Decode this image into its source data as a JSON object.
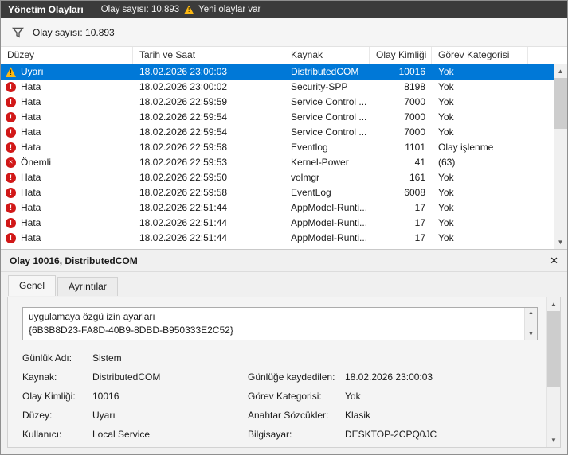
{
  "title_bar": {
    "title": "Yönetim Olayları",
    "event_count": "Olay sayısı: 10.893",
    "new_events": "Yeni olaylar var"
  },
  "filter_bar": {
    "event_count": "Olay sayısı: 10.893"
  },
  "table": {
    "columns": [
      "Düzey",
      "Tarih ve Saat",
      "Kaynak",
      "Olay Kimliği",
      "Görev Kategorisi"
    ],
    "rows": [
      {
        "icon": "warning",
        "level": "Uyarı",
        "datetime": "18.02.2026 23:00:03",
        "source": "DistributedCOM",
        "event_id": "10016",
        "category": "Yok",
        "selected": true
      },
      {
        "icon": "error",
        "level": "Hata",
        "datetime": "18.02.2026 23:00:02",
        "source": "Security-SPP",
        "event_id": "8198",
        "category": "Yok",
        "selected": false
      },
      {
        "icon": "error",
        "level": "Hata",
        "datetime": "18.02.2026 22:59:59",
        "source": "Service Control ...",
        "event_id": "7000",
        "category": "Yok",
        "selected": false
      },
      {
        "icon": "error",
        "level": "Hata",
        "datetime": "18.02.2026 22:59:54",
        "source": "Service Control ...",
        "event_id": "7000",
        "category": "Yok",
        "selected": false
      },
      {
        "icon": "error",
        "level": "Hata",
        "datetime": "18.02.2026 22:59:54",
        "source": "Service Control ...",
        "event_id": "7000",
        "category": "Yok",
        "selected": false
      },
      {
        "icon": "error",
        "level": "Hata",
        "datetime": "18.02.2026 22:59:58",
        "source": "Eventlog",
        "event_id": "1101",
        "category": "Olay işlenme",
        "selected": false
      },
      {
        "icon": "critical",
        "level": "Önemli",
        "datetime": "18.02.2026 22:59:53",
        "source": "Kernel-Power",
        "event_id": "41",
        "category": "(63)",
        "selected": false
      },
      {
        "icon": "error",
        "level": "Hata",
        "datetime": "18.02.2026 22:59:50",
        "source": "volmgr",
        "event_id": "161",
        "category": "Yok",
        "selected": false
      },
      {
        "icon": "error",
        "level": "Hata",
        "datetime": "18.02.2026 22:59:58",
        "source": "EventLog",
        "event_id": "6008",
        "category": "Yok",
        "selected": false
      },
      {
        "icon": "error",
        "level": "Hata",
        "datetime": "18.02.2026 22:51:44",
        "source": "AppModel-Runti...",
        "event_id": "17",
        "category": "Yok",
        "selected": false
      },
      {
        "icon": "error",
        "level": "Hata",
        "datetime": "18.02.2026 22:51:44",
        "source": "AppModel-Runti...",
        "event_id": "17",
        "category": "Yok",
        "selected": false
      },
      {
        "icon": "error",
        "level": "Hata",
        "datetime": "18.02.2026 22:51:44",
        "source": "AppModel-Runti...",
        "event_id": "17",
        "category": "Yok",
        "selected": false
      }
    ]
  },
  "details": {
    "header": "Olay 10016, DistributedCOM",
    "close_label": "✕",
    "tabs": [
      {
        "label": "Genel",
        "name": "general",
        "active": true
      },
      {
        "label": "Ayrıntılar",
        "name": "details",
        "active": false
      }
    ],
    "description_lines": [
      "uygulamaya özgü izin ayarları",
      "{6B3B8D23-FA8D-40B9-8DBD-B950333E2C52}"
    ],
    "field_rows": [
      {
        "left_label": "Günlük Adı:",
        "left_value": "Sistem",
        "right_label": "",
        "right_value": ""
      },
      {
        "left_label": "Kaynak:",
        "left_value": "DistributedCOM",
        "right_label": "Günlüğe kaydedilen:",
        "right_value": "18.02.2026 23:00:03"
      },
      {
        "left_label": "Olay Kimliği:",
        "left_value": "10016",
        "right_label": "Görev Kategorisi:",
        "right_value": "Yok"
      },
      {
        "left_label": "Düzey:",
        "left_value": "Uyarı",
        "right_label": "Anahtar Sözcükler:",
        "right_value": "Klasik"
      },
      {
        "left_label": "Kullanıcı:",
        "left_value": "Local Service",
        "right_label": "Bilgisayar:",
        "right_value": "DESKTOP-2CPQ0JC"
      }
    ]
  },
  "colors": {
    "selection": "#0078d7",
    "titlebar_bg": "#3b3b3b",
    "error_icon": "#d11818",
    "critical_icon": "#d11818",
    "warning_icon": "#fdb913"
  }
}
